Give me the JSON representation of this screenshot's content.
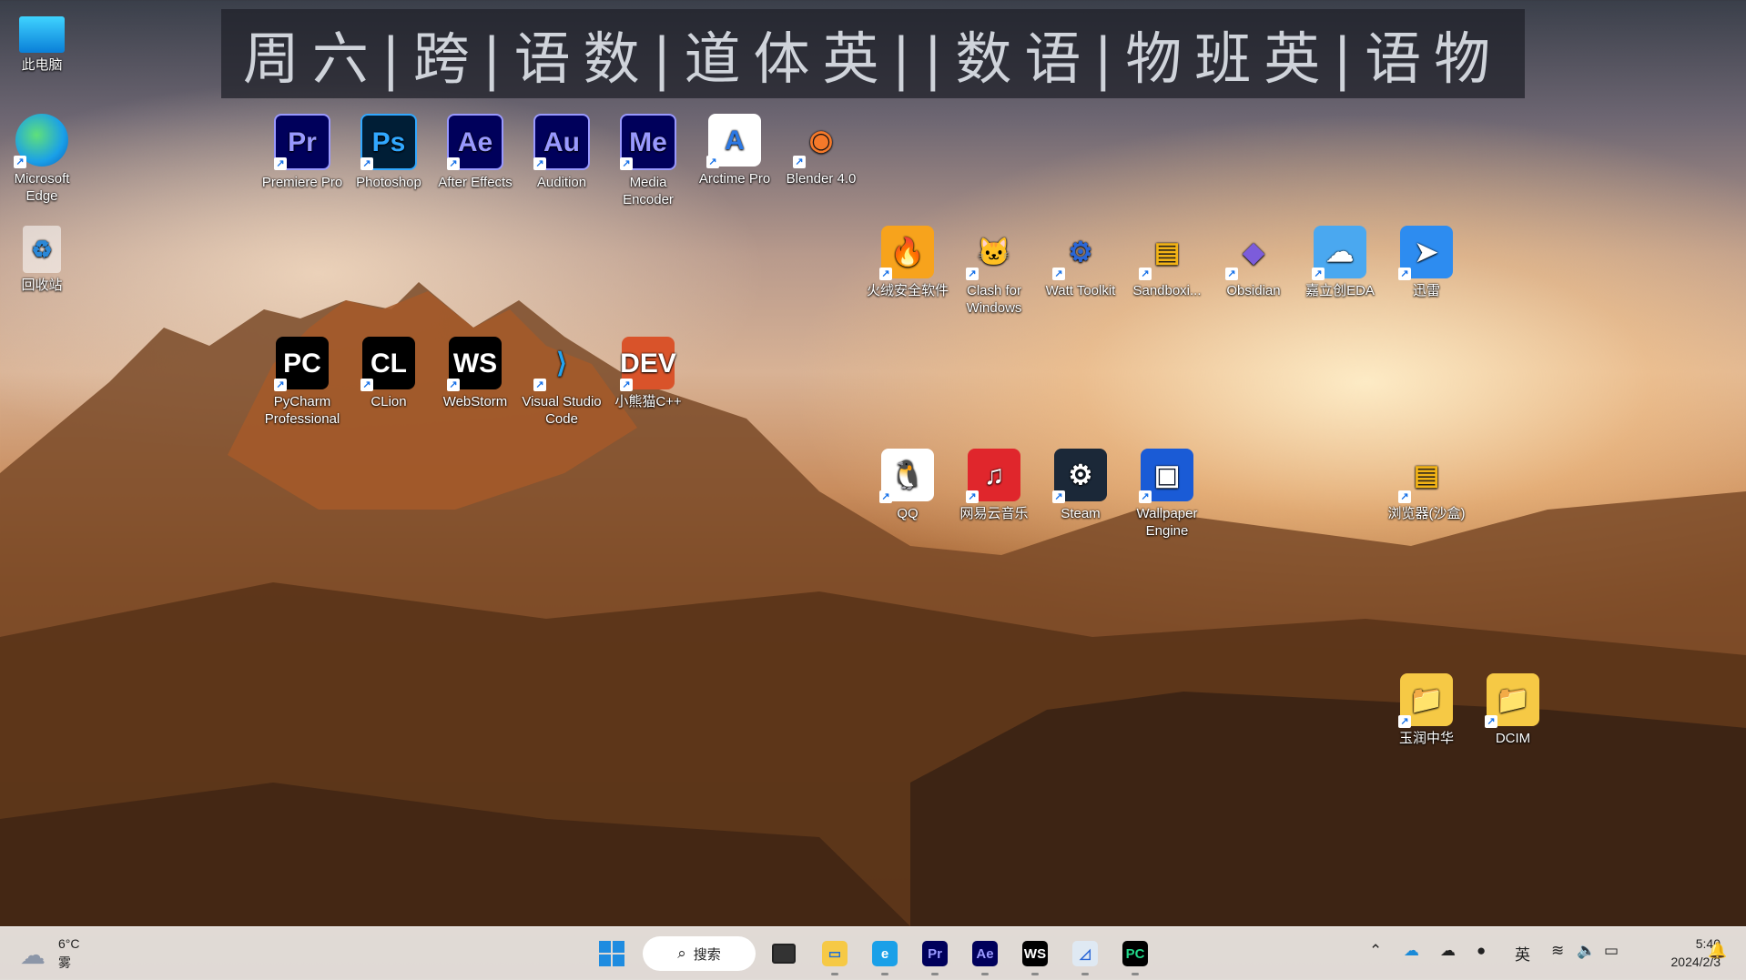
{
  "schedule_banner": "周六|跨|语数|道体英||数语|物班英|语物",
  "desktop": {
    "left_column": [
      {
        "label": "此电脑",
        "icon": "monitor-icon"
      },
      {
        "label": "Microsoft Edge",
        "icon": "edge-icon"
      },
      {
        "label": "回收站",
        "icon": "recycle-bin-icon"
      }
    ],
    "row1": [
      {
        "label": "Premiere Pro",
        "glyph": "Pr",
        "bg": "#00005b",
        "fg": "#9999ff"
      },
      {
        "label": "Photoshop",
        "glyph": "Ps",
        "bg": "#001e36",
        "fg": "#31a8ff"
      },
      {
        "label": "After Effects",
        "glyph": "Ae",
        "bg": "#00005b",
        "fg": "#9999ff"
      },
      {
        "label": "Audition",
        "glyph": "Au",
        "bg": "#00005b",
        "fg": "#9999ff"
      },
      {
        "label": "Media Encoder",
        "glyph": "Me",
        "bg": "#00005b",
        "fg": "#9999ff"
      },
      {
        "label": "Arctime Pro",
        "glyph": "A",
        "bg": "#ffffff",
        "fg": "#2b78e4"
      },
      {
        "label": "Blender 4.0",
        "glyph": "◉",
        "bg": "transparent",
        "fg": "#f5792a"
      }
    ],
    "row2": [
      {
        "label": "火绒安全软件",
        "glyph": "🔥",
        "bg": "#f7a31c",
        "fg": "#ffffff"
      },
      {
        "label": "Clash for Windows",
        "glyph": "🐱",
        "bg": "transparent",
        "fg": "#1c2a44"
      },
      {
        "label": "Watt Toolkit",
        "glyph": "⚙",
        "bg": "transparent",
        "fg": "#2a66d6"
      },
      {
        "label": "Sandboxi...",
        "glyph": "▤",
        "bg": "transparent",
        "fg": "#f2b316"
      },
      {
        "label": "Obsidian",
        "glyph": "◆",
        "bg": "transparent",
        "fg": "#7c5cdb"
      },
      {
        "label": "嘉立创EDA",
        "glyph": "☁",
        "bg": "#4aa8f0",
        "fg": "#ffffff"
      },
      {
        "label": "迅雷",
        "glyph": "➤",
        "bg": "#2d8cf0",
        "fg": "#ffffff"
      }
    ],
    "row3": [
      {
        "label": "PyCharm Professional",
        "glyph": "PC",
        "bg": "#000000",
        "fg": "#ffffff"
      },
      {
        "label": "CLion",
        "glyph": "CL",
        "bg": "#000000",
        "fg": "#ffffff"
      },
      {
        "label": "WebStorm",
        "glyph": "WS",
        "bg": "#000000",
        "fg": "#ffffff"
      },
      {
        "label": "Visual Studio Code",
        "glyph": "⟩",
        "bg": "transparent",
        "fg": "#23a3f0"
      },
      {
        "label": "小熊猫C++",
        "glyph": "DEV",
        "bg": "#d9532a",
        "fg": "#ffffff"
      }
    ],
    "row4": [
      {
        "label": "QQ",
        "glyph": "🐧",
        "bg": "#ffffff",
        "fg": "#000000"
      },
      {
        "label": "网易云音乐",
        "glyph": "♫",
        "bg": "#e0262c",
        "fg": "#ffffff"
      },
      {
        "label": "Steam",
        "glyph": "⚙",
        "bg": "#1b2838",
        "fg": "#ffffff"
      },
      {
        "label": "Wallpaper Engine",
        "glyph": "▣",
        "bg": "#1a5bd6",
        "fg": "#ffffff"
      }
    ],
    "right_icons": [
      {
        "label": "浏览器(沙盒)",
        "glyph": "▤",
        "bg": "transparent",
        "fg": "#f2b316"
      },
      {
        "label": "玉润中华",
        "glyph": "📁",
        "bg": "#f6c945",
        "fg": "#f6c945"
      },
      {
        "label": "DCIM",
        "glyph": "📁",
        "bg": "#f6c945",
        "fg": "#f6c945"
      }
    ]
  },
  "taskbar": {
    "weather_temp": "6°C",
    "weather_desc": "雾",
    "search_label": "搜索",
    "apps": [
      {
        "name": "file-explorer",
        "glyph": "▭",
        "bg": "#f6c945",
        "fg": "#1f6fd6"
      },
      {
        "name": "edge",
        "glyph": "e",
        "bg": "#1aa0e8",
        "fg": "#ffffff"
      },
      {
        "name": "premiere",
        "glyph": "Pr",
        "bg": "#00005b",
        "fg": "#9999ff"
      },
      {
        "name": "after-effects",
        "glyph": "Ae",
        "bg": "#00005b",
        "fg": "#9999ff"
      },
      {
        "name": "webstorm",
        "glyph": "WS",
        "bg": "#000000",
        "fg": "#ffffff"
      },
      {
        "name": "task-manager",
        "glyph": "◿",
        "bg": "#dfe9f3",
        "fg": "#2a66d6"
      },
      {
        "name": "pycharm",
        "glyph": "PC",
        "bg": "#000000",
        "fg": "#21d789"
      }
    ],
    "ime": "英",
    "time": "5:40",
    "date": "2024/2/3"
  }
}
